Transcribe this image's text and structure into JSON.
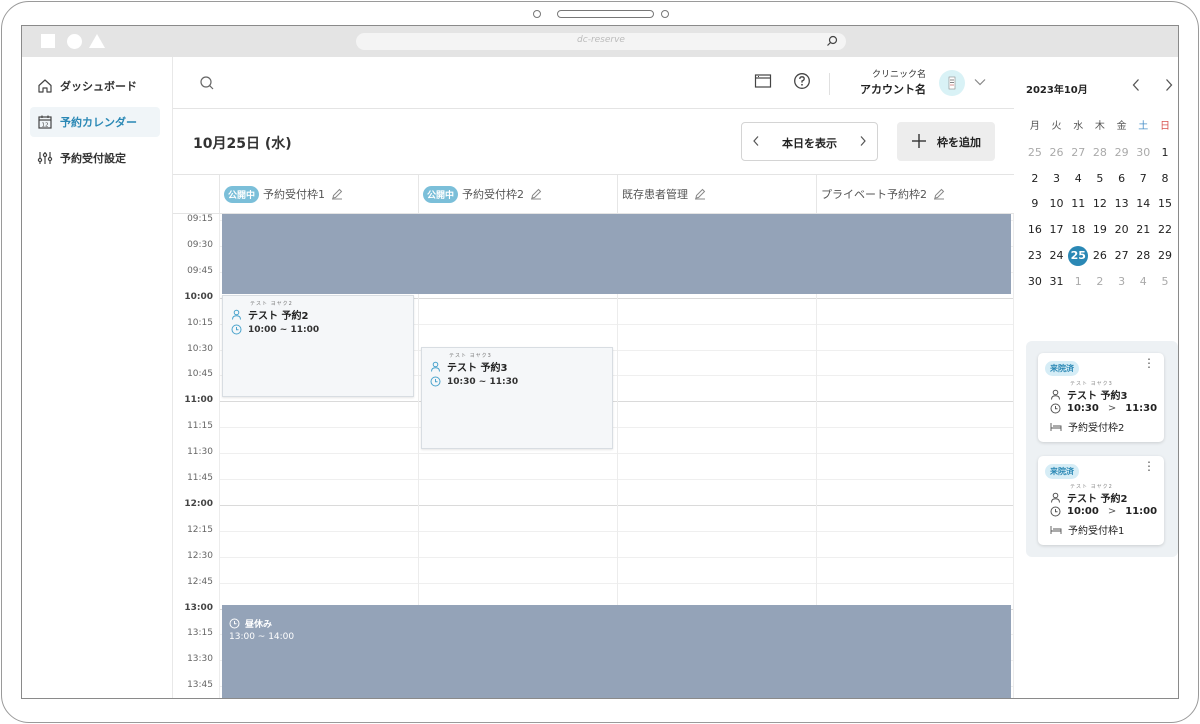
{
  "browser": {
    "url": "dc-reserve"
  },
  "sidebar": {
    "items": [
      {
        "label": "ダッシュボード",
        "icon": "home-icon"
      },
      {
        "label": "予約カレンダー",
        "icon": "calendar-icon"
      },
      {
        "label": "予約受付設定",
        "icon": "sliders-icon"
      }
    ]
  },
  "header": {
    "clinic": "クリニック名",
    "account": "アカウント名"
  },
  "toolbar": {
    "date": "10月25日 (水)",
    "today_label": "本日を表示",
    "add_label": "枠を追加"
  },
  "columns": [
    {
      "badge": "公開中",
      "name": "予約受付枠1"
    },
    {
      "badge": "公開中",
      "name": "予約受付枠2"
    },
    {
      "badge": "",
      "name": "既存患者管理"
    },
    {
      "badge": "",
      "name": "プライベート予約枠2"
    }
  ],
  "times": [
    "09:15",
    "09:30",
    "09:45",
    "10:00",
    "10:15",
    "10:30",
    "10:45",
    "11:00",
    "11:15",
    "11:30",
    "11:45",
    "12:00",
    "12:15",
    "12:30",
    "12:45",
    "13:00",
    "13:15",
    "13:30",
    "13:45"
  ],
  "appointments": [
    {
      "ruby": "テスト ヨヤク2",
      "name": "テスト 予約2",
      "time": "10:00 ~ 11:00"
    },
    {
      "ruby": "テスト ヨヤク3",
      "name": "テスト 予約3",
      "time": "10:30 ~ 11:30"
    }
  ],
  "lunch": {
    "label": "昼休み",
    "time": "13:00 ~ 14:00"
  },
  "mini_calendar": {
    "month": "2023年10月",
    "weekdays": [
      "月",
      "火",
      "水",
      "木",
      "金",
      "土",
      "日"
    ],
    "weeks": [
      [
        "25",
        "26",
        "27",
        "28",
        "29",
        "30",
        "1"
      ],
      [
        "2",
        "3",
        "4",
        "5",
        "6",
        "7",
        "8"
      ],
      [
        "9",
        "10",
        "11",
        "12",
        "13",
        "14",
        "15"
      ],
      [
        "16",
        "17",
        "18",
        "19",
        "20",
        "21",
        "22"
      ],
      [
        "23",
        "24",
        "25",
        "26",
        "27",
        "28",
        "29"
      ],
      [
        "30",
        "31",
        "1",
        "2",
        "3",
        "4",
        "5"
      ]
    ],
    "selected": "25"
  },
  "visit_cards": [
    {
      "status": "来院済",
      "ruby": "テスト ヨヤク3",
      "name": "テスト 予約3",
      "start": "10:30",
      "arrow": ">",
      "end": "11:30",
      "slot": "予約受付枠2"
    },
    {
      "status": "来院済",
      "ruby": "テスト ヨヤク2",
      "name": "テスト 予約2",
      "start": "10:00",
      "arrow": ">",
      "end": "11:00",
      "slot": "予約受付枠1"
    }
  ],
  "colors": {
    "accent": "#2a88b5",
    "blocked": "#94a3b8",
    "badge": "#7bbfd9"
  }
}
